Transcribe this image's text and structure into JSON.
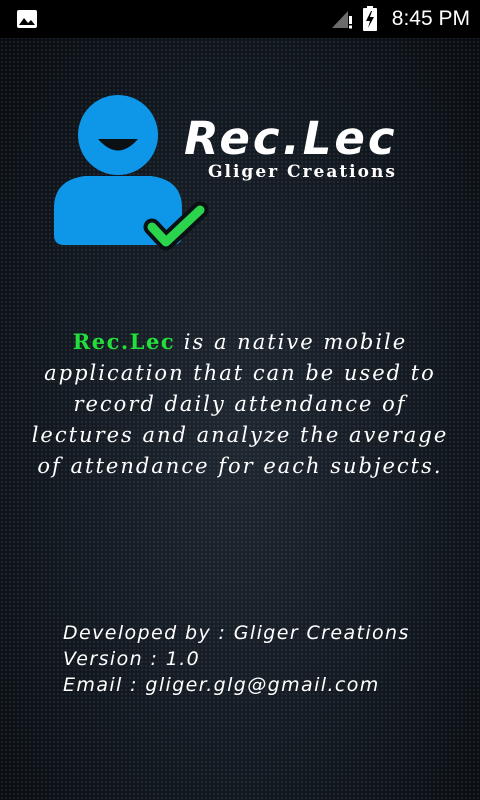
{
  "status_bar": {
    "time": "8:45 PM",
    "icons": [
      "image-notification-icon",
      "signal-icon",
      "battery-charging-icon"
    ]
  },
  "logo": {
    "icon": "user-check-icon",
    "title": "Rec.Lec",
    "subtitle": "Gliger Creations"
  },
  "description": {
    "brand": "Rec.Lec",
    "text": " is a native mobile application that can be used to record daily attendance of lectures and analyze the average of attendance for each subjects."
  },
  "info": {
    "developer": "Developed by : Gliger Creations",
    "version": "Version : 1.0",
    "email": "Email : gliger.glg@gmail.com"
  },
  "colors": {
    "brand_green": "#22e03a",
    "avatar_blue": "#0e96e8",
    "check_green": "#2ad44c",
    "background": "#0d1117"
  }
}
